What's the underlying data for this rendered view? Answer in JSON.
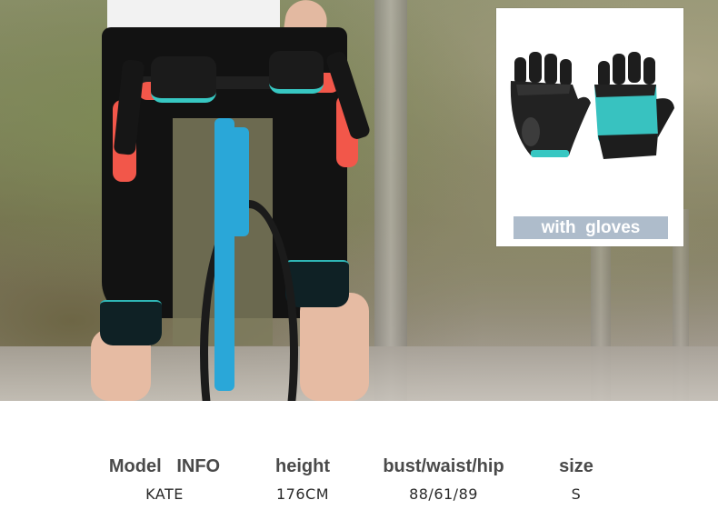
{
  "inset": {
    "caption": "with  gloves",
    "caption_bg": "#aebccb",
    "image": "half-finger-cycling-gloves-black-teal"
  },
  "hero": {
    "image": "cyclist-in-black-capri-shorts-on-blue-road-bike",
    "accent": "#2fb6b6",
    "bar_tape": "#f2574a",
    "frame": "#2aa7d8"
  },
  "model_info": {
    "columns": [
      {
        "header": "Model   INFO",
        "value": "KATE"
      },
      {
        "header": "height",
        "value": "176CM"
      },
      {
        "header": "bust/waist/hip",
        "value": "88/61/89"
      },
      {
        "header": "size",
        "value": "S"
      }
    ]
  }
}
